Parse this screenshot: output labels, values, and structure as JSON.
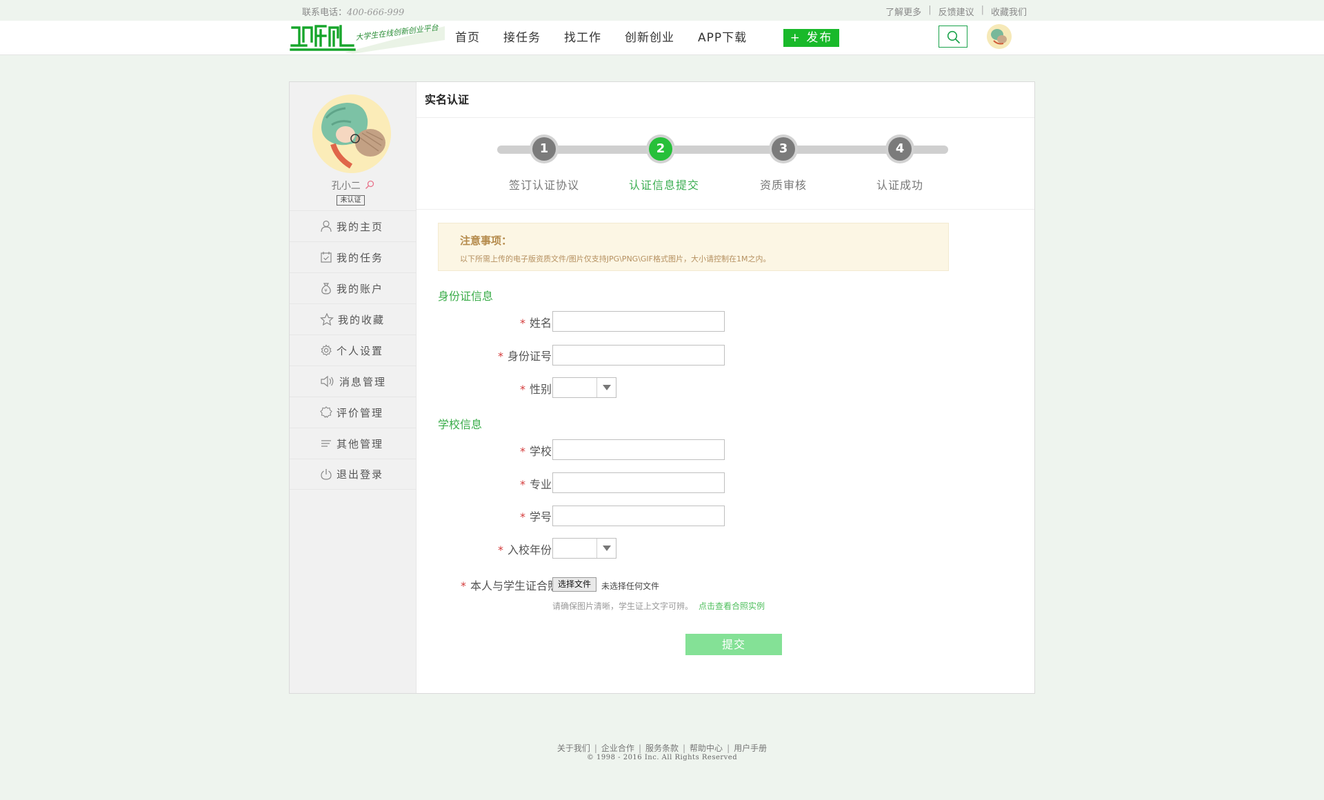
{
  "topbar": {
    "phone_label": "联系电话：",
    "phone_number": "400-666-999",
    "links": [
      "了解更多",
      "反馈建议",
      "收藏我们"
    ]
  },
  "header": {
    "logo_text": "创客创业",
    "logo_slogan": "大学生在线创新创业平台",
    "nav": [
      "首页",
      "接任务",
      "找工作",
      "创新创业",
      "APP下载"
    ],
    "publish_label": "+ 发布"
  },
  "sidebar": {
    "username": "孔小二",
    "badge": "未认证",
    "menu": [
      "我的主页",
      "我的任务",
      "我的账户",
      "我的收藏",
      "个人设置",
      "消息管理",
      "评价管理",
      "其他管理",
      "退出登录"
    ]
  },
  "content": {
    "title": "实名认证",
    "steps": [
      {
        "num": "1",
        "label": "签订认证协议"
      },
      {
        "num": "2",
        "label": "认证信息提交"
      },
      {
        "num": "3",
        "label": "资质审核"
      },
      {
        "num": "4",
        "label": "认证成功"
      }
    ],
    "active_step": 2,
    "notice": {
      "title": "注意事项：",
      "text": "以下所需上传的电子版资质文件/图片仅支持JPG\\PNG\\GIF格式图片，大小请控制在1M之内。"
    },
    "id_section": {
      "title": "身份证信息",
      "name_label": "姓名",
      "id_label": "身份证号",
      "gender_label": "性别",
      "gender_value": ""
    },
    "school_section": {
      "title": "学校信息",
      "school_label": "学校",
      "major_label": "专业",
      "student_id_label": "学号",
      "year_label": "入校年份",
      "year_value": ""
    },
    "photo": {
      "label": "本人与学生证合照",
      "button": "选择文件",
      "status": "未选择任何文件",
      "hint": "请确保图片清晰，学生证上文字可辨。",
      "example_link": "点击查看合照实例"
    },
    "required_mark": "*",
    "submit_label": "提交"
  },
  "footer": {
    "links": [
      "关于我们",
      "企业合作",
      "服务条款",
      "帮助中心",
      "用户手册"
    ],
    "copyright": "© 1998 - 2016  Inc. All Rights Reserved"
  },
  "colors": {
    "brand_green": "#19b92a",
    "active_step": "#27c03a",
    "section_title": "#3aac49",
    "submit_bg": "#84e196",
    "page_bg": "#eef4ee"
  }
}
